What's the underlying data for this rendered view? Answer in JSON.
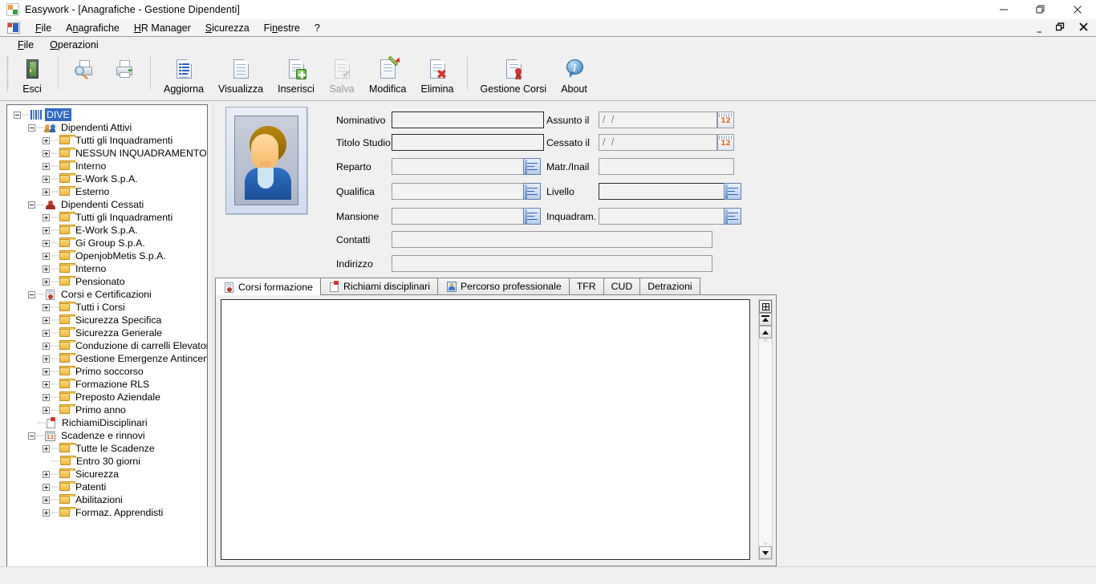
{
  "window": {
    "title": "Easywork - [Anagrafiche - Gestione Dipendenti]",
    "app_icon": "easywork-logo-icon",
    "controls": {
      "minimize": "—",
      "restore": "❐",
      "close": "✕"
    }
  },
  "mdi_controls": {
    "minimize": "_",
    "restore": "❐",
    "close": "✕"
  },
  "menubar": {
    "mdi_icon": "mdi-window-icon",
    "items": [
      {
        "label": "File",
        "accel": "F"
      },
      {
        "label": "Anagrafiche",
        "accel": "A"
      },
      {
        "label": "HR Manager",
        "accel": "H"
      },
      {
        "label": "Sicurezza",
        "accel": "S"
      },
      {
        "label": "Finestre",
        "accel": "n"
      },
      {
        "label": "?",
        "accel": ""
      }
    ]
  },
  "child_menubar": {
    "items": [
      {
        "label": "File",
        "accel": "F"
      },
      {
        "label": "Operazioni",
        "accel": "O"
      }
    ]
  },
  "toolbar": {
    "buttons": [
      {
        "label": "Esci",
        "icon": "exit-door-icon",
        "disabled": false
      },
      {
        "label": "",
        "icon": "print-preview-icon",
        "disabled": false
      },
      {
        "label": "",
        "icon": "print-icon",
        "disabled": false
      },
      {
        "label": "Aggiorna",
        "icon": "refresh-list-icon",
        "disabled": false
      },
      {
        "label": "Visualizza",
        "icon": "view-document-icon",
        "disabled": false
      },
      {
        "label": "Inserisci",
        "icon": "insert-document-icon",
        "disabled": false
      },
      {
        "label": "Salva",
        "icon": "save-document-icon",
        "disabled": true
      },
      {
        "label": "Modifica",
        "icon": "edit-pencil-icon",
        "disabled": false
      },
      {
        "label": "Elimina",
        "icon": "delete-document-icon",
        "disabled": false
      },
      {
        "label": "Gestione Corsi",
        "icon": "courses-certificate-icon",
        "disabled": false
      },
      {
        "label": "About",
        "icon": "info-balloon-icon",
        "disabled": false
      }
    ]
  },
  "module": {
    "title": "Anagrafiche - Gestione Dipendenti",
    "icon": "person-blue-icon",
    "title_color": "#31445c"
  },
  "tree": {
    "nodes": [
      {
        "level": 0,
        "label": "DIVE",
        "icon": "dive-root-icon",
        "expander": "minus",
        "selected": true
      },
      {
        "level": 1,
        "label": "Dipendenti Attivi",
        "icon": "people-group-icon",
        "expander": "minus",
        "selected": false
      },
      {
        "level": 2,
        "label": "Tutti gli Inquadramenti",
        "icon": "folder-icon",
        "expander": "plus",
        "selected": false
      },
      {
        "level": 2,
        "label": "NESSUN INQUADRAMENTO",
        "icon": "folder-icon",
        "expander": "plus",
        "selected": false
      },
      {
        "level": 2,
        "label": "Interno",
        "icon": "folder-icon",
        "expander": "plus",
        "selected": false
      },
      {
        "level": 2,
        "label": "E-Work S.p.A.",
        "icon": "folder-icon",
        "expander": "plus",
        "selected": false
      },
      {
        "level": 2,
        "label": "Esterno",
        "icon": "folder-icon",
        "expander": "plus",
        "selected": false
      },
      {
        "level": 1,
        "label": "Dipendenti Cessati",
        "icon": "person-red-icon",
        "expander": "minus",
        "selected": false
      },
      {
        "level": 2,
        "label": "Tutti gli Inquadramenti",
        "icon": "folder-icon",
        "expander": "plus",
        "selected": false
      },
      {
        "level": 2,
        "label": "E-Work S.p.A.",
        "icon": "folder-icon",
        "expander": "plus",
        "selected": false
      },
      {
        "level": 2,
        "label": "Gi Group S.p.A.",
        "icon": "folder-icon",
        "expander": "plus",
        "selected": false
      },
      {
        "level": 2,
        "label": "OpenjobMetis S.p.A.",
        "icon": "folder-icon",
        "expander": "plus",
        "selected": false
      },
      {
        "level": 2,
        "label": "Interno",
        "icon": "folder-icon",
        "expander": "plus",
        "selected": false
      },
      {
        "level": 2,
        "label": "Pensionato",
        "icon": "folder-icon",
        "expander": "plus",
        "selected": false
      },
      {
        "level": 1,
        "label": "Corsi e Certificazioni",
        "icon": "certificate-icon",
        "expander": "minus",
        "selected": false
      },
      {
        "level": 2,
        "label": "Tutti i Corsi",
        "icon": "folder-icon",
        "expander": "plus",
        "selected": false
      },
      {
        "level": 2,
        "label": "Sicurezza Specifica",
        "icon": "folder-icon",
        "expander": "plus",
        "selected": false
      },
      {
        "level": 2,
        "label": "Sicurezza Generale",
        "icon": "folder-icon",
        "expander": "plus",
        "selected": false
      },
      {
        "level": 2,
        "label": "Conduzione di carrelli Elevatori",
        "icon": "folder-icon",
        "expander": "plus",
        "selected": false
      },
      {
        "level": 2,
        "label": "Gestione Emergenze Antincendio",
        "icon": "folder-icon",
        "expander": "plus",
        "selected": false
      },
      {
        "level": 2,
        "label": "Primo soccorso",
        "icon": "folder-icon",
        "expander": "plus",
        "selected": false
      },
      {
        "level": 2,
        "label": "Formazione RLS",
        "icon": "folder-icon",
        "expander": "plus",
        "selected": false
      },
      {
        "level": 2,
        "label": "Preposto Aziendale",
        "icon": "folder-icon",
        "expander": "plus",
        "selected": false
      },
      {
        "level": 2,
        "label": "Primo anno",
        "icon": "folder-icon",
        "expander": "plus",
        "selected": false
      },
      {
        "level": 1,
        "label": "RichiamiDisciplinari",
        "icon": "notepad-red-clip-icon",
        "expander": "none",
        "selected": false
      },
      {
        "level": 1,
        "label": "Scadenze e rinnovi",
        "icon": "calendar-icon",
        "expander": "minus",
        "selected": false
      },
      {
        "level": 2,
        "label": "Tutte le Scadenze",
        "icon": "folder-icon",
        "expander": "plus",
        "selected": false
      },
      {
        "level": 2,
        "label": "Entro 30 giorni",
        "icon": "folder-icon",
        "expander": "none",
        "selected": false
      },
      {
        "level": 2,
        "label": "Sicurezza",
        "icon": "folder-icon",
        "expander": "plus",
        "selected": false
      },
      {
        "level": 2,
        "label": "Patenti",
        "icon": "folder-icon",
        "expander": "plus",
        "selected": false
      },
      {
        "level": 2,
        "label": "Abilitazioni",
        "icon": "folder-icon",
        "expander": "plus",
        "selected": false
      },
      {
        "level": 2,
        "label": "Formaz. Apprendisti",
        "icon": "folder-icon",
        "expander": "plus",
        "selected": false
      }
    ]
  },
  "photo": {
    "alt": "employee-photo-placeholder"
  },
  "form": {
    "left_fields": [
      {
        "label": "Nominativo",
        "value": "",
        "kind": "text"
      },
      {
        "label": "Titolo Studio",
        "value": "",
        "kind": "text"
      },
      {
        "label": "Reparto",
        "value": "",
        "kind": "lookup"
      },
      {
        "label": "Qualifica",
        "value": "",
        "kind": "lookup"
      },
      {
        "label": "Mansione",
        "value": "",
        "kind": "lookup"
      }
    ],
    "right_fields": [
      {
        "label": "Assunto il",
        "value": "/  /",
        "kind": "date"
      },
      {
        "label": "Cessato il",
        "value": "/  /",
        "kind": "date"
      },
      {
        "label": "Matr./Inail",
        "value": "",
        "kind": "text"
      },
      {
        "label": "Livello",
        "value": "",
        "kind": "lookup"
      },
      {
        "label": "Inquadram.",
        "value": "",
        "kind": "lookup"
      }
    ],
    "wide_fields": [
      {
        "label": "Contatti",
        "value": "",
        "kind": "text"
      },
      {
        "label": "Indirizzo",
        "value": "",
        "kind": "text"
      }
    ]
  },
  "tabs": {
    "active_index": 0,
    "items": [
      {
        "label": "Corsi formazione",
        "icon": "certificate-icon"
      },
      {
        "label": "Richiami disciplinari",
        "icon": "notepad-red-clip-icon"
      },
      {
        "label": "Percorso professionale",
        "icon": "person-card-icon"
      },
      {
        "label": "TFR",
        "icon": ""
      },
      {
        "label": "CUD",
        "icon": ""
      },
      {
        "label": "Detrazioni",
        "icon": ""
      }
    ]
  },
  "grid": {
    "rows": [],
    "scrollbar": {
      "select_all_icon": "grid-select-all-icon",
      "top_icon": "scroll-to-top-icon",
      "up_icon": "scroll-up-icon",
      "page_up_icon": "page-up-chevron-icon",
      "page_down_icon": "page-down-chevron-icon",
      "down_icon": "scroll-down-icon"
    }
  },
  "colors": {
    "window_bg": "#f0f0f0",
    "panel_white": "#ffffff",
    "selection_blue": "#316ac5",
    "field_bg": "#f2f2f2",
    "border_gray": "#808080",
    "title_text": "#31445c"
  }
}
